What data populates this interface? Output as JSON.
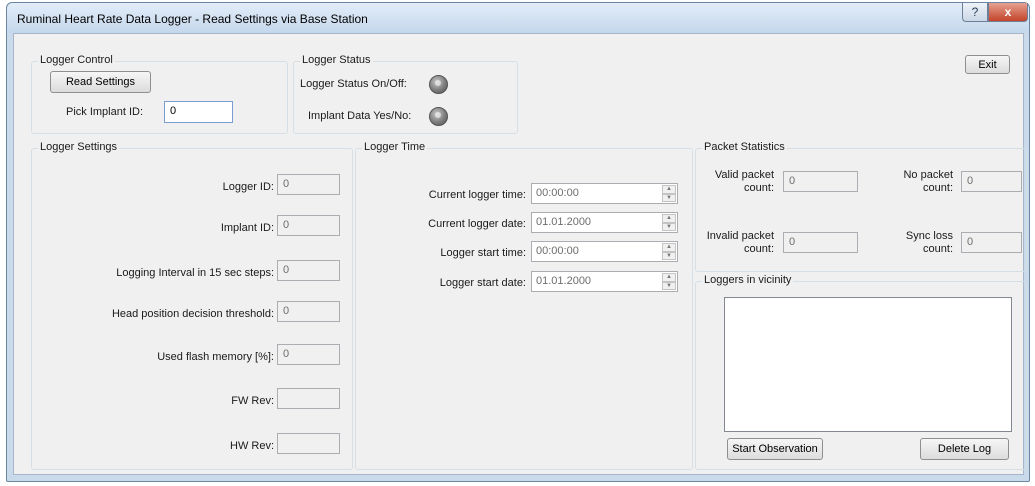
{
  "window": {
    "title": "Ruminal Heart Rate Data Logger - Read Settings via Base Station",
    "help_glyph": "?",
    "close_glyph": "x"
  },
  "logger_control": {
    "title": "Logger Control",
    "read_settings_label": "Read Settings",
    "pick_implant_label": "Pick Implant ID:",
    "pick_implant_value": "0"
  },
  "logger_status": {
    "title": "Logger Status",
    "status_onoff_label": "Logger Status On/Off:",
    "implant_data_label": "Implant Data Yes/No:"
  },
  "exit_label": "Exit",
  "logger_settings": {
    "title": "Logger Settings",
    "logger_id_label": "Logger ID:",
    "logger_id_value": "0",
    "implant_id_label": "Implant ID:",
    "implant_id_value": "0",
    "logging_interval_label": "Logging Interval in 15 sec steps:",
    "logging_interval_value": "0",
    "head_position_label": "Head position decision threshold:",
    "head_position_value": "0",
    "flash_memory_label": "Used flash memory [%]:",
    "flash_memory_value": "0",
    "fw_rev_label": "FW Rev:",
    "fw_rev_value": "",
    "hw_rev_label": "HW Rev:",
    "hw_rev_value": ""
  },
  "logger_time": {
    "title": "Logger Time",
    "current_time_label": "Current logger time:",
    "current_time_value": "00:00:00",
    "current_date_label": "Current logger date:",
    "current_date_value": "01.01.2000",
    "start_time_label": "Logger start time:",
    "start_time_value": "00:00:00",
    "start_date_label": "Logger start date:",
    "start_date_value": "01.01.2000"
  },
  "packet_statistics": {
    "title": "Packet Statistics",
    "valid_label_1": "Valid packet",
    "valid_label_2": "count:",
    "valid_value": "0",
    "no_packet_label_1": "No packet",
    "no_packet_label_2": "count:",
    "no_packet_value": "0",
    "invalid_label_1": "Invalid packet",
    "invalid_label_2": "count:",
    "invalid_value": "0",
    "sync_loss_label_1": "Sync loss",
    "sync_loss_label_2": "count:",
    "sync_loss_value": "0"
  },
  "loggers_vicinity": {
    "title": "Loggers in vicinity",
    "start_observation_label": "Start Observation",
    "delete_log_label": "Delete Log"
  }
}
